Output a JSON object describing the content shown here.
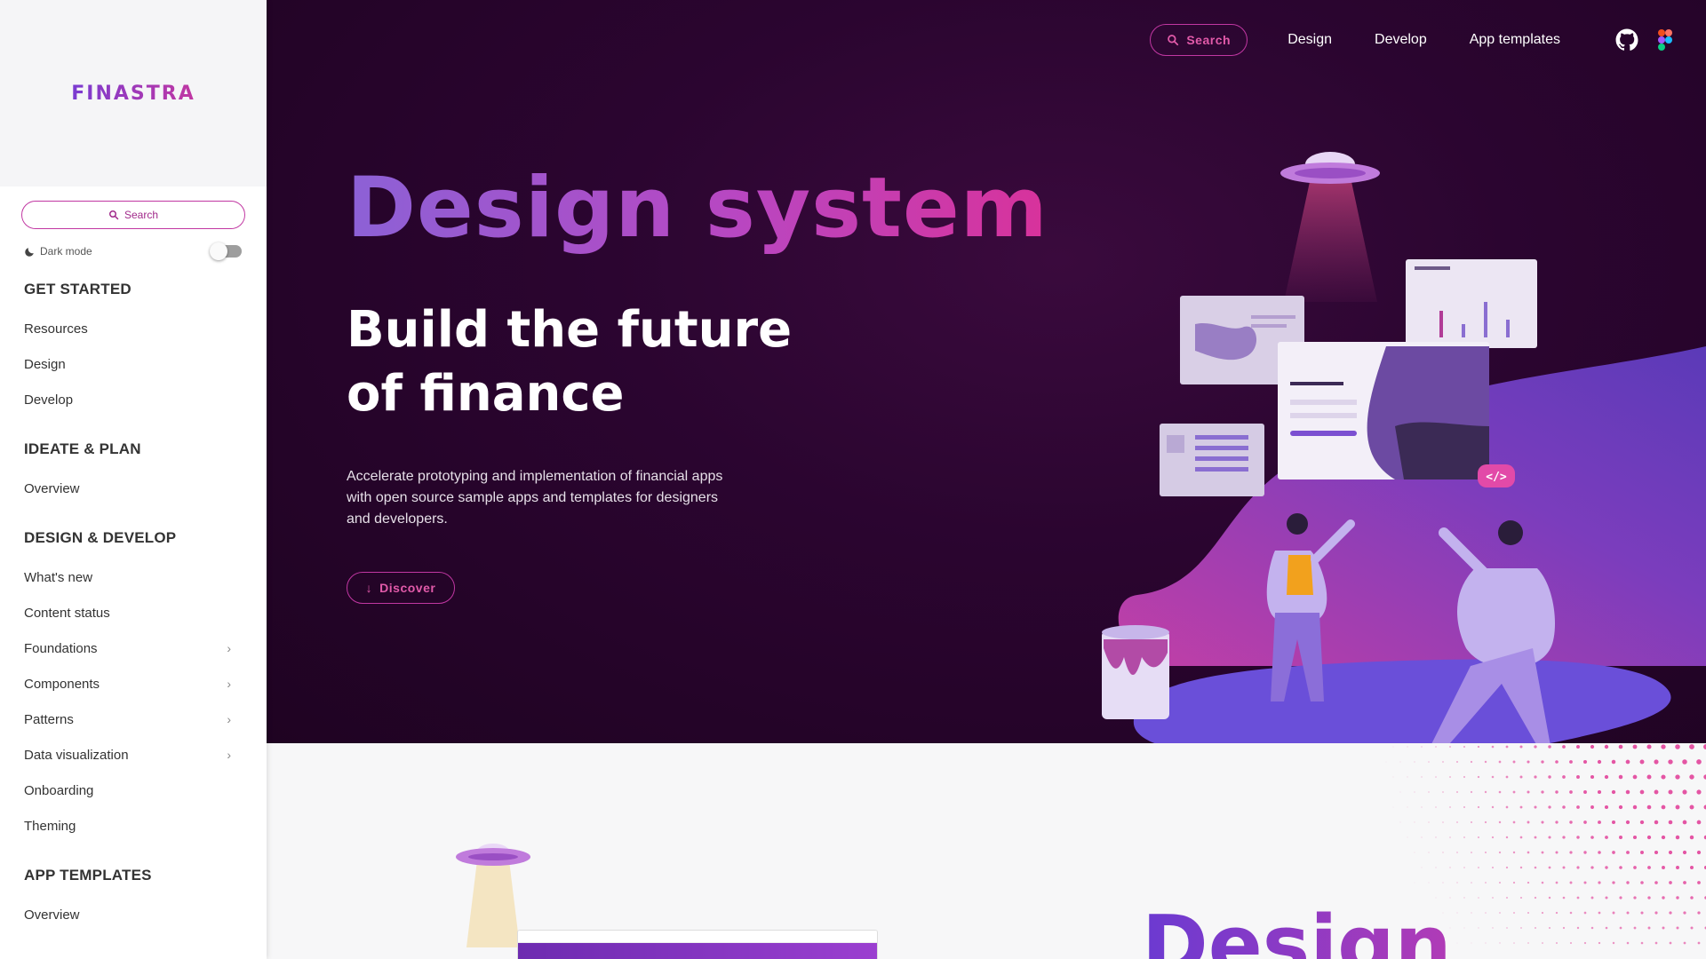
{
  "sidebar": {
    "logo": "FINASTRA",
    "search_label": "Search",
    "dark_mode_label": "Dark mode",
    "sections": [
      {
        "title": "GET STARTED",
        "items": [
          {
            "label": "Resources",
            "has_children": false
          },
          {
            "label": "Design",
            "has_children": false
          },
          {
            "label": "Develop",
            "has_children": false
          }
        ]
      },
      {
        "title": "IDEATE & PLAN",
        "items": [
          {
            "label": "Overview",
            "has_children": false
          }
        ]
      },
      {
        "title": "DESIGN & DEVELOP",
        "items": [
          {
            "label": "What's new",
            "has_children": false
          },
          {
            "label": "Content status",
            "has_children": false
          },
          {
            "label": "Foundations",
            "has_children": true
          },
          {
            "label": "Components",
            "has_children": true
          },
          {
            "label": "Patterns",
            "has_children": true
          },
          {
            "label": "Data visualization",
            "has_children": true
          },
          {
            "label": "Onboarding",
            "has_children": false
          },
          {
            "label": "Theming",
            "has_children": false
          }
        ]
      },
      {
        "title": "APP TEMPLATES",
        "items": [
          {
            "label": "Overview",
            "has_children": false
          }
        ]
      }
    ]
  },
  "topnav": {
    "search_label": "Search",
    "links": [
      "Design",
      "Develop",
      "App templates"
    ],
    "icons": [
      "github-icon",
      "figma-icon"
    ]
  },
  "hero": {
    "title": "Design system",
    "subtitle": "Build the future of finance",
    "description": "Accelerate prototyping and implementation of financial apps with open source sample apps and templates for designers and developers.",
    "cta_label": "Discover"
  },
  "lower": {
    "title": "Design"
  },
  "colors": {
    "accent_pink": "#c137a2",
    "accent_purple": "#7a3bd1",
    "hero_bg": "#2b0530"
  }
}
